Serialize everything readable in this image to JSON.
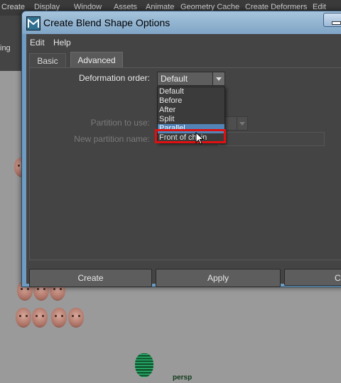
{
  "background": {
    "menubar_items": [
      "Create",
      "Display",
      "Window",
      "Assets",
      "Animate",
      "Geometry Cache",
      "Create Deformers",
      "Edit Deformers"
    ],
    "shelf_label": "ing",
    "viewport_label": "persp"
  },
  "dialog": {
    "title": "Create Blend Shape Options",
    "menu": [
      "Edit",
      "Help"
    ],
    "tabs": [
      {
        "label": "Basic",
        "active": false
      },
      {
        "label": "Advanced",
        "active": true
      }
    ],
    "deformation_order": {
      "label": "Deformation order:",
      "value": "Default",
      "options": [
        "Default",
        "Before",
        "After",
        "Split",
        "Parallel",
        "Front of chain"
      ],
      "highlighted": "Parallel"
    },
    "partition_to_use": {
      "label": "Partition to use:",
      "value": "n"
    },
    "new_partition_name": {
      "label": "New partition name:",
      "value": ""
    },
    "buttons": {
      "create": "Create",
      "apply": "Apply",
      "close": "C"
    }
  },
  "colors": {
    "selection": "#5284b8",
    "highlight_box": "#e01010",
    "panel": "#444444"
  }
}
